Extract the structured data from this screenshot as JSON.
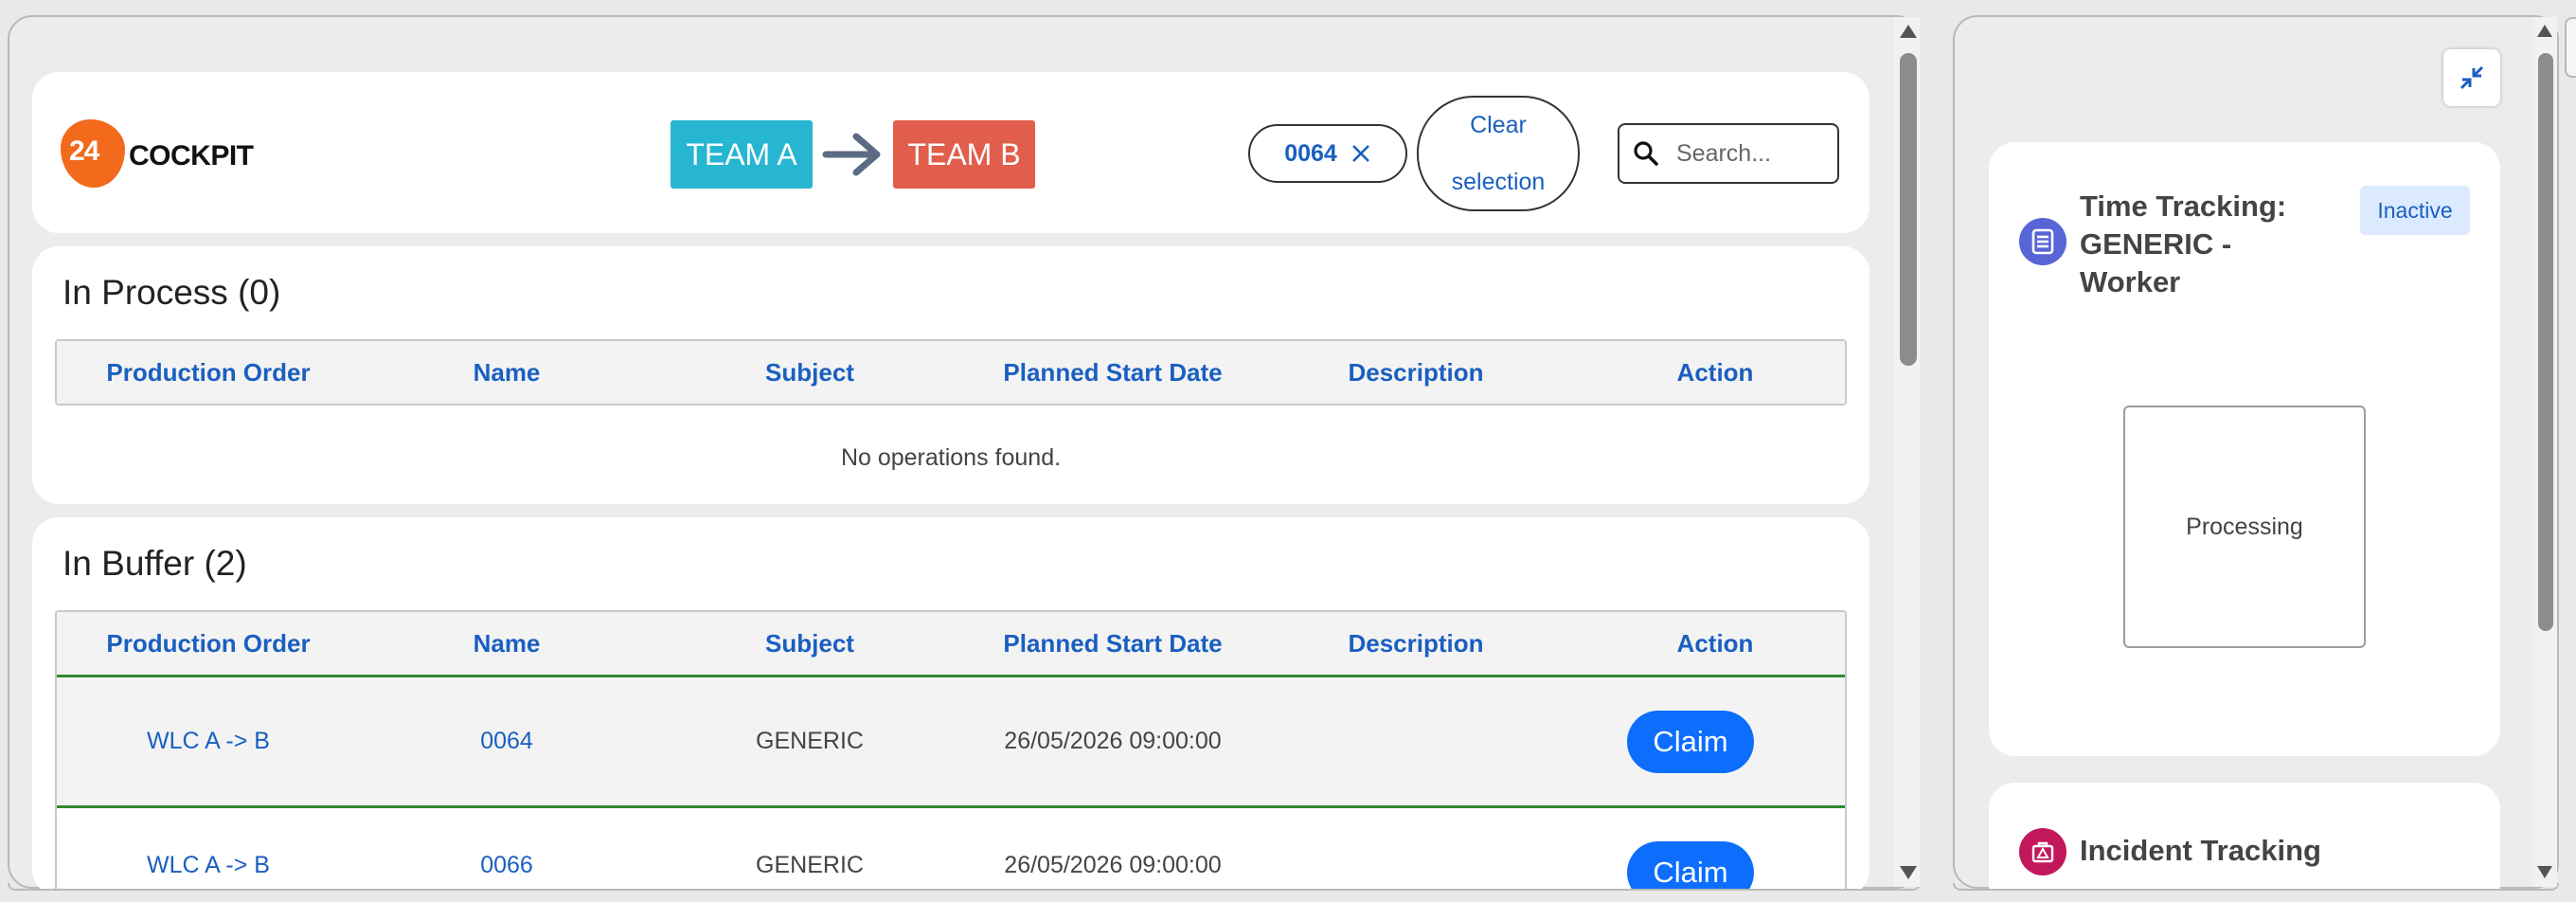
{
  "header": {
    "logo_number": "24",
    "logo_word": "COCKPIT",
    "team_from": "TEAM A",
    "team_to": "TEAM B",
    "filter_chip": "0064",
    "clear_label_line1": "Clear",
    "clear_label_line2": "selection",
    "search_placeholder": "Search..."
  },
  "columns": [
    "Production Order",
    "Name",
    "Subject",
    "Planned Start Date",
    "Description",
    "Action"
  ],
  "in_process": {
    "title": "In Process (0)",
    "empty_text": "No operations found."
  },
  "in_buffer": {
    "title": "In Buffer (2)",
    "rows": [
      {
        "order": "WLC A -> B",
        "name": "0064",
        "subject": "GENERIC",
        "date": "26/05/2026 09:00:00",
        "description": "",
        "action": "Claim"
      },
      {
        "order": "WLC A -> B",
        "name": "0066",
        "subject": "GENERIC",
        "date": "26/05/2026 09:00:00",
        "description": "",
        "action": "Claim"
      }
    ]
  },
  "side_panel": {
    "time_tracking_title": "Time Tracking: GENERIC - Worker",
    "time_tracking_line1": "Time Tracking:",
    "time_tracking_line2": "GENERIC -",
    "time_tracking_line3": "Worker",
    "status_badge": "Inactive",
    "processing_label": "Processing",
    "incident_title": "Incident Tracking"
  },
  "colors": {
    "brand_orange": "#f26a1b",
    "team_a": "#27b6d1",
    "team_b": "#e15e4c",
    "link_blue": "#1a5fc1",
    "claim_blue": "#0d6efd",
    "row_divider_green": "#2e8b2e"
  }
}
